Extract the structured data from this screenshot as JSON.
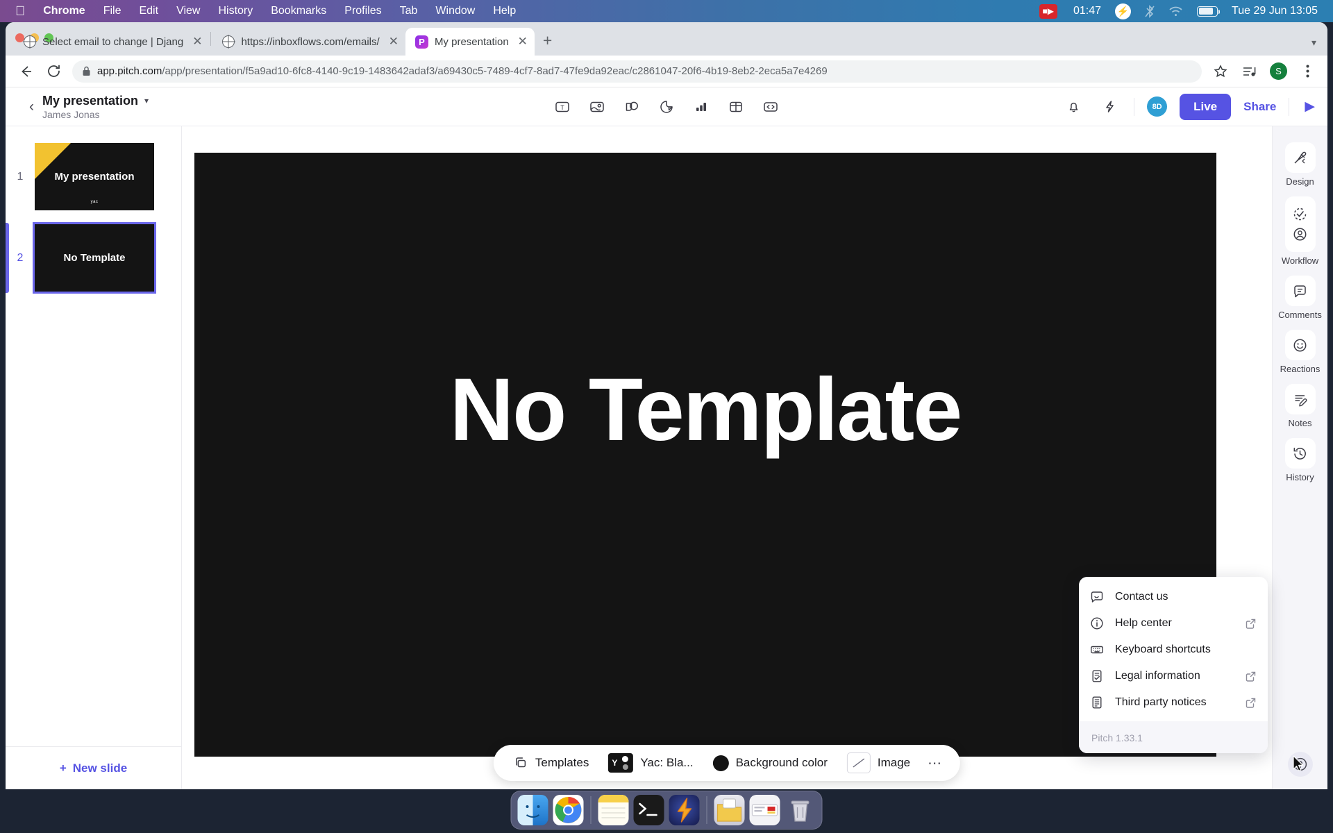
{
  "menubar": {
    "apple_icon": "apple-logo-icon",
    "items": [
      {
        "label": "Chrome",
        "bold": true
      },
      {
        "label": "File",
        "bold": false
      },
      {
        "label": "Edit",
        "bold": false
      },
      {
        "label": "View",
        "bold": false
      },
      {
        "label": "History",
        "bold": false
      },
      {
        "label": "Bookmarks",
        "bold": false
      },
      {
        "label": "Profiles",
        "bold": false
      },
      {
        "label": "Tab",
        "bold": false
      },
      {
        "label": "Window",
        "bold": false
      },
      {
        "label": "Help",
        "bold": false
      }
    ],
    "recording_time": "01:47",
    "status_icons": [
      "screen-recording-icon",
      "bolt-icon",
      "bluetooth-off-icon",
      "wifi-icon",
      "battery-icon"
    ],
    "datetime": "Tue 29 Jun  13:05"
  },
  "browser": {
    "tabs": [
      {
        "title": "Select email to change | Djang",
        "favicon": "globe-icon",
        "active": false
      },
      {
        "title": "https://inboxflows.com/emails/",
        "favicon": "globe-icon",
        "active": false
      },
      {
        "title": "My presentation",
        "favicon": "pitch-icon",
        "active": true
      }
    ],
    "new_tab_label": "+",
    "url_main": "app.pitch.com",
    "url_path": "/app/presentation/f5a9ad10-6fc8-4140-9c19-1483642adaf3/a69430c5-7489-4cf7-8ad7-47fe9da92eac/c2861047-20f6-4b19-8eb2-2eca5a7e4269",
    "profile_initial": "S",
    "lock_icon": "lock-icon",
    "star_icon": "bookmark-star-icon",
    "menu_icon": "kebab-menu-icon"
  },
  "app": {
    "header": {
      "back_icon": "back-chevron-icon",
      "presentation_title": "My presentation",
      "owner": "James Jonas",
      "dropdown_icon": "chevron-down-icon",
      "tools": [
        {
          "name": "text-tool",
          "glyph": "T"
        },
        {
          "name": "image-tool",
          "glyph": "image"
        },
        {
          "name": "shapes-tool",
          "glyph": "shapes"
        },
        {
          "name": "sticker-tool",
          "glyph": "sticker"
        },
        {
          "name": "chart-tool",
          "glyph": "chart"
        },
        {
          "name": "table-tool",
          "glyph": "table"
        },
        {
          "name": "embed-tool",
          "glyph": "code"
        }
      ],
      "notification_icon": "bell-icon",
      "automation_icon": "lightning-icon",
      "presence_initials": "8D",
      "live_label": "Live",
      "share_label": "Share",
      "present_icon": "play-icon"
    },
    "slides": [
      {
        "number": "1",
        "title": "My presentation",
        "logo": "yac",
        "selected": false,
        "has_corner": true
      },
      {
        "number": "2",
        "title": "No Template",
        "logo": "",
        "selected": true,
        "has_corner": false
      }
    ],
    "new_slide_label": "New slide",
    "new_slide_icon": "plus-icon",
    "canvas": {
      "slide_text": "No Template",
      "background_color": "#141414",
      "text_color": "#ffffff"
    },
    "bottom_toolbar": {
      "templates_label": "Templates",
      "templates_icon": "templates-icon",
      "theme_label": "Yac: Bla...",
      "theme_thumb_letter": "Y",
      "background_label": "Background color",
      "background_swatch": "#141414",
      "image_label": "Image",
      "image_icon": "no-image-icon",
      "more_icon": "more-dots-icon"
    },
    "rail": [
      {
        "label": "Design",
        "icon": "design-brush-icon",
        "tall": false
      },
      {
        "label": "Workflow",
        "icon": "workflow-check-icon",
        "tall": true
      },
      {
        "label": "Comments",
        "icon": "comment-icon",
        "tall": false
      },
      {
        "label": "Reactions",
        "icon": "smiley-icon",
        "tall": false
      },
      {
        "label": "Notes",
        "icon": "notes-pencil-icon",
        "tall": false
      },
      {
        "label": "History",
        "icon": "history-clock-icon",
        "tall": false
      }
    ],
    "help_fab_icon": "help-question-icon",
    "help_menu": {
      "items": [
        {
          "label": "Contact us",
          "icon": "chat-bubble-icon",
          "external": false
        },
        {
          "label": "Help center",
          "icon": "info-circle-icon",
          "external": true
        },
        {
          "label": "Keyboard shortcuts",
          "icon": "keyboard-icon",
          "external": false
        },
        {
          "label": "Legal information",
          "icon": "legal-doc-icon",
          "external": true
        },
        {
          "label": "Third party notices",
          "icon": "document-icon",
          "external": true
        }
      ],
      "version": "Pitch 1.33.1"
    }
  },
  "dock": {
    "apps": [
      {
        "name": "finder",
        "running": true
      },
      {
        "name": "chrome",
        "running": true
      },
      {
        "name": "notes",
        "running": true
      },
      {
        "name": "terminal",
        "running": true
      },
      {
        "name": "lightning-app",
        "running": true
      },
      {
        "name": "downloads-folder",
        "running": false
      },
      {
        "name": "download-item",
        "running": false
      },
      {
        "name": "trash",
        "running": false
      }
    ]
  },
  "colors": {
    "accent": "#5653e3",
    "slide_bg": "#141414",
    "rail_bg": "#f5f5f9",
    "yellow": "#f2c230"
  }
}
